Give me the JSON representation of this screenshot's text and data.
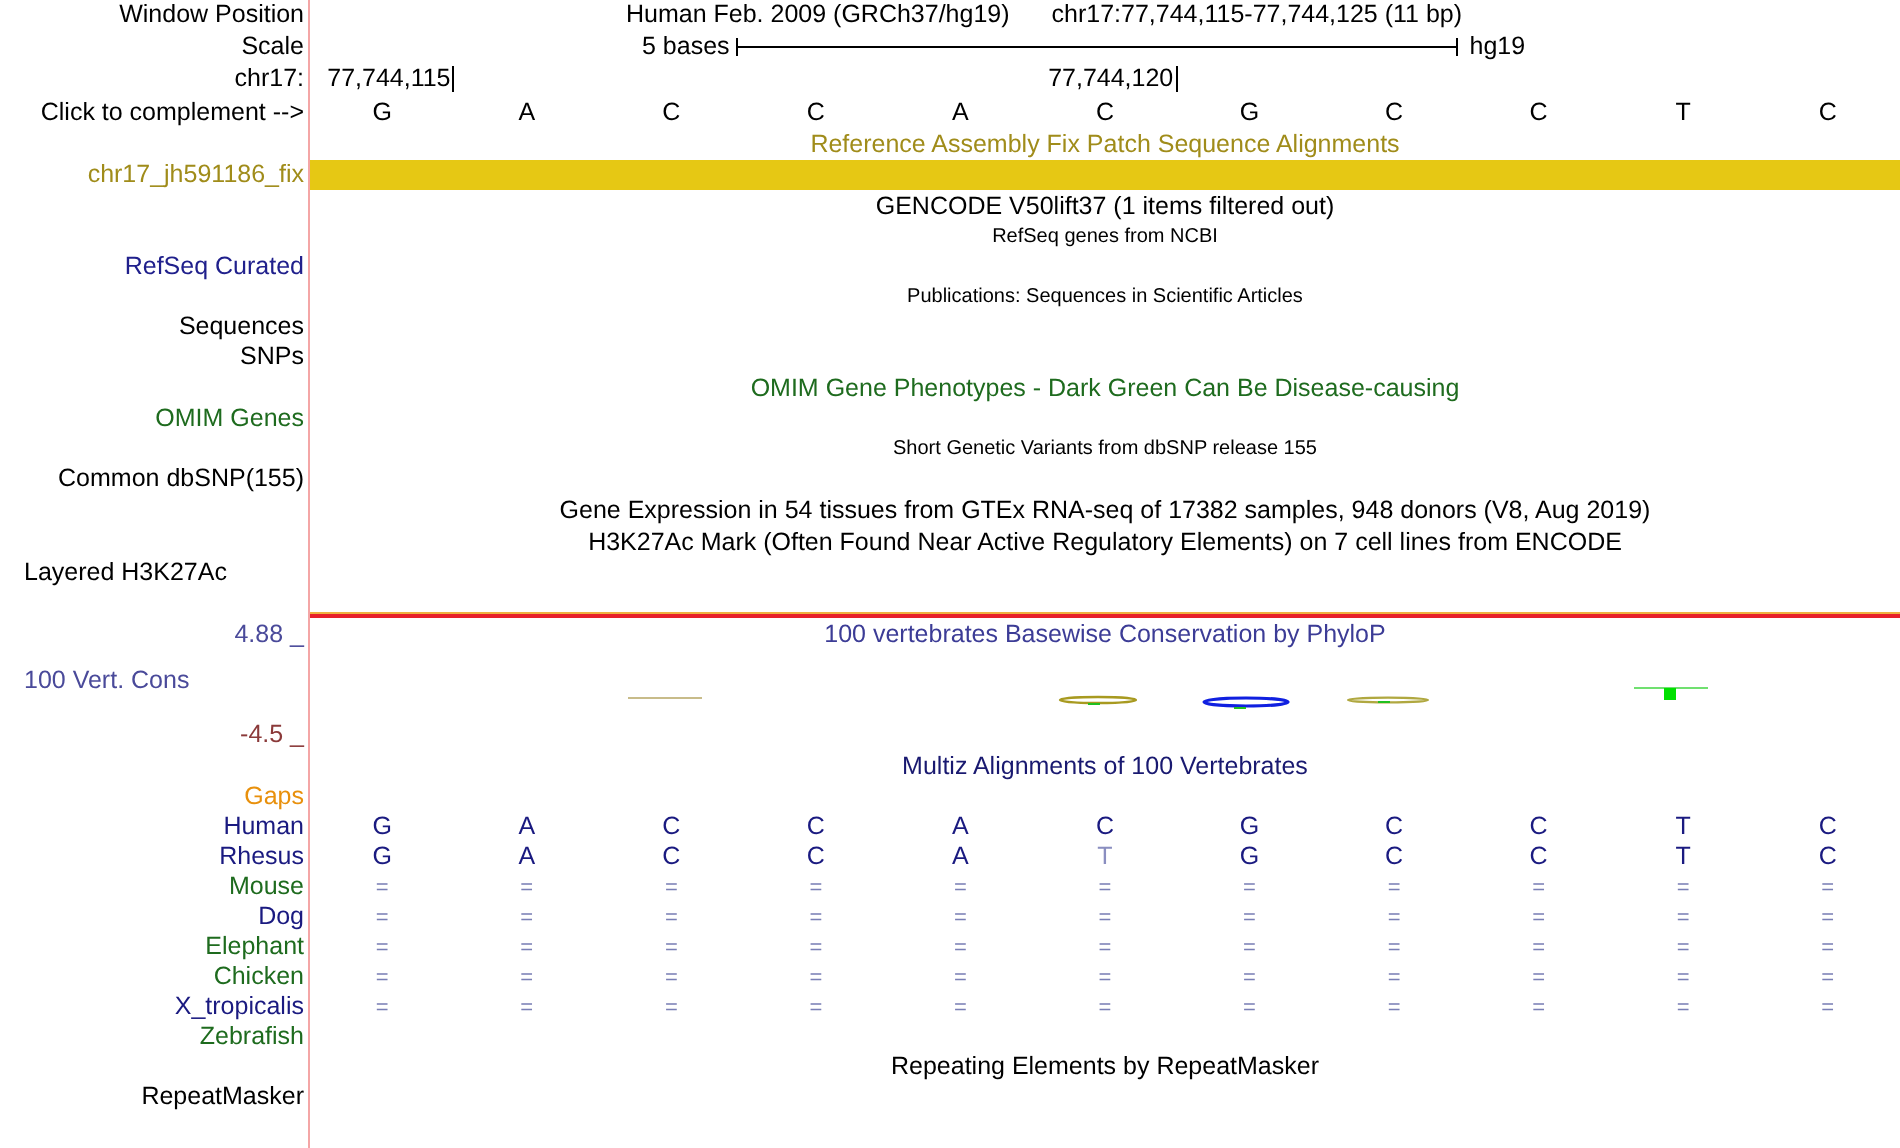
{
  "header": {
    "label": "Window Position",
    "assembly": "Human Feb. 2009 (GRCh37/hg19)",
    "position": "chr17:77,744,115-77,744,125 (11 bp)"
  },
  "scale": {
    "label": "Scale",
    "length": "5 bases",
    "assembly": "hg19"
  },
  "coordinates": {
    "label": "chr17:",
    "ticks": [
      "77,744,115",
      "77,744,120"
    ]
  },
  "sequence": {
    "label": "Click to complement -->",
    "bases": [
      "G",
      "A",
      "C",
      "C",
      "A",
      "C",
      "G",
      "C",
      "C",
      "T",
      "C"
    ]
  },
  "tracks": [
    {
      "kind": "title",
      "text": "Reference Assembly Fix Patch Sequence Alignments",
      "color": "#a08c1a"
    },
    {
      "kind": "bar",
      "text": "chr17_jh591186_fix",
      "color": "#a08c1a"
    },
    {
      "kind": "title",
      "text": "GENCODE V50lift37 (1 items filtered out)",
      "color": "#000000"
    },
    {
      "kind": "note",
      "text": "RefSeq genes from NCBI",
      "color": "#000000"
    },
    {
      "kind": "label",
      "text": "RefSeq Curated",
      "color": "#20208c"
    },
    {
      "kind": "note",
      "text": "Publications: Sequences in Scientific Articles",
      "color": "#000000"
    },
    {
      "kind": "label",
      "text": "Sequences",
      "color": "#000000"
    },
    {
      "kind": "label",
      "text": "SNPs",
      "color": "#000000"
    },
    {
      "kind": "title",
      "text": "OMIM Gene Phenotypes - Dark Green Can Be Disease-causing",
      "color": "#1e6b1e"
    },
    {
      "kind": "label",
      "text": "OMIM Genes",
      "color": "#1e6b1e"
    },
    {
      "kind": "note",
      "text": "Short Genetic Variants from dbSNP release 155",
      "color": "#000000"
    },
    {
      "kind": "label",
      "text": "Common dbSNP(155)",
      "color": "#000000"
    },
    {
      "kind": "title",
      "text": "Gene Expression in 54 tissues from GTEx RNA-seq of 17382 samples, 948 donors (V8, Aug 2019)",
      "color": "#000000"
    },
    {
      "kind": "title",
      "text": "H3K27Ac Mark (Often Found Near Active Regulatory Elements) on 7 cell lines from ENCODE",
      "color": "#000000"
    },
    {
      "kind": "leftlabel",
      "text": "Layered H3K27Ac",
      "color": "#000000"
    }
  ],
  "conservation": {
    "max": "4.88 _",
    "title": "100 vertebrates Basewise Conservation by PhyloP",
    "label": "100 Vert. Cons",
    "min": "-4.5 _"
  },
  "multiz": {
    "title": "Multiz Alignments of 100 Vertebrates",
    "gaps": "Gaps",
    "species": [
      {
        "name": "Human",
        "color": "#1a1a80",
        "bases": [
          "G",
          "A",
          "C",
          "C",
          "A",
          "C",
          "G",
          "C",
          "C",
          "T",
          "C"
        ]
      },
      {
        "name": "Rhesus",
        "color": "#1a1a80",
        "bases": [
          "G",
          "A",
          "C",
          "C",
          "A",
          "T",
          "G",
          "C",
          "C",
          "T",
          "C"
        ]
      },
      {
        "name": "Mouse",
        "color": "#1e6b1e",
        "bases": [
          "=",
          "=",
          "=",
          "=",
          "=",
          "=",
          "=",
          "=",
          "=",
          "=",
          "="
        ]
      },
      {
        "name": "Dog",
        "color": "#1a1a80",
        "bases": [
          "=",
          "=",
          "=",
          "=",
          "=",
          "=",
          "=",
          "=",
          "=",
          "=",
          "="
        ]
      },
      {
        "name": "Elephant",
        "color": "#1e6b1e",
        "bases": [
          "=",
          "=",
          "=",
          "=",
          "=",
          "=",
          "=",
          "=",
          "=",
          "=",
          "="
        ]
      },
      {
        "name": "Chicken",
        "color": "#1e6b1e",
        "bases": [
          "=",
          "=",
          "=",
          "=",
          "=",
          "=",
          "=",
          "=",
          "=",
          "=",
          "="
        ]
      },
      {
        "name": "X_tropicalis",
        "color": "#1a1a80",
        "bases": [
          "=",
          "=",
          "=",
          "=",
          "=",
          "=",
          "=",
          "=",
          "=",
          "=",
          "="
        ]
      },
      {
        "name": "Zebrafish",
        "color": "#1e6b1e"
      }
    ]
  },
  "repeats": {
    "title": "Repeating Elements by RepeatMasker",
    "label": "RepeatMasker"
  }
}
